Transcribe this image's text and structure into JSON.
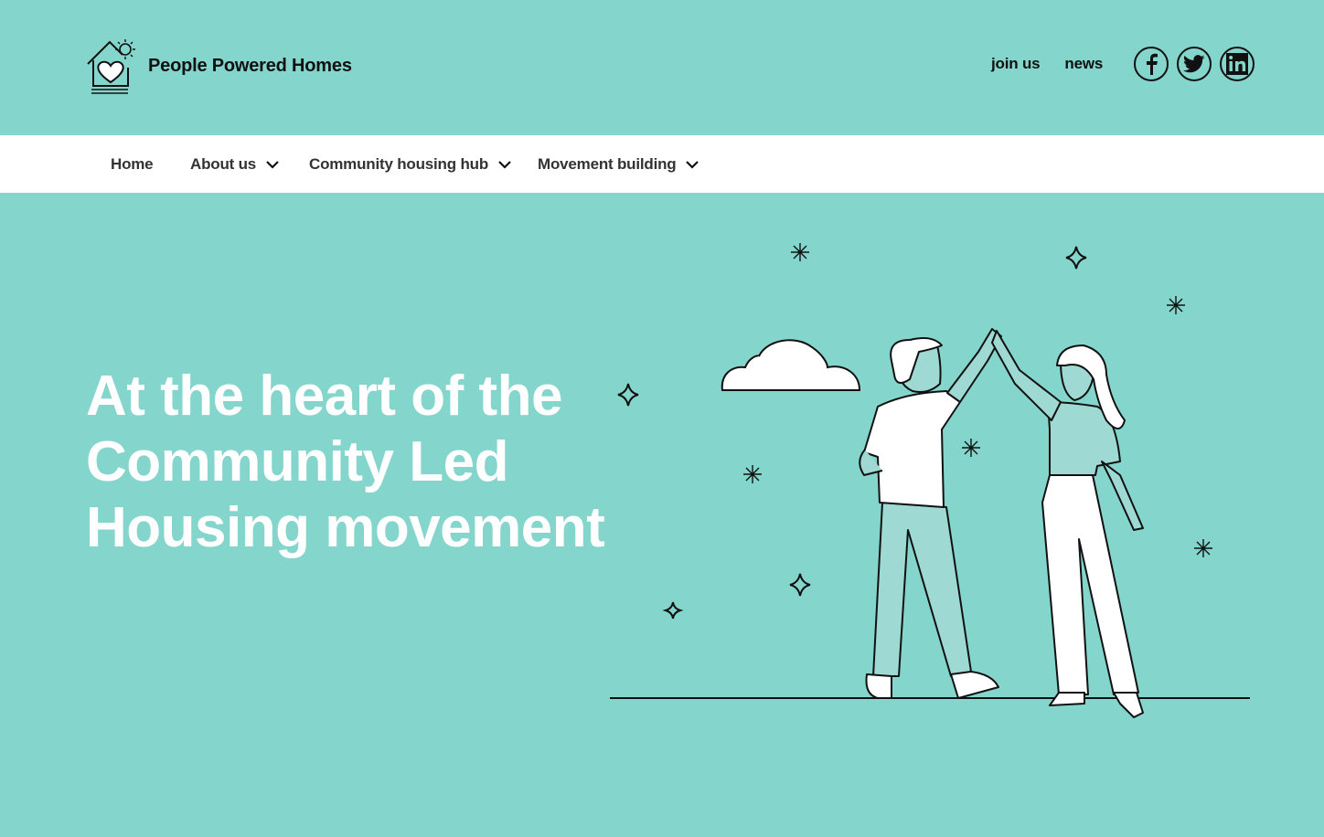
{
  "brand": {
    "name": "People Powered Homes",
    "logo_icon": "house-heart-icon"
  },
  "top_links": [
    {
      "label": "join us"
    },
    {
      "label": "news"
    }
  ],
  "social": [
    {
      "icon": "facebook-icon"
    },
    {
      "icon": "twitter-icon"
    },
    {
      "icon": "linkedin-icon"
    }
  ],
  "nav": [
    {
      "label": "Home"
    },
    {
      "label": "About us"
    },
    {
      "label": "Community housing hub"
    },
    {
      "label": "Movement building"
    }
  ],
  "hero": {
    "line1": "At the heart of the",
    "line2": "Community Led",
    "line3": "Housing movement"
  },
  "colors": {
    "background": "#84d5cc",
    "nav_bg": "#ffffff",
    "hero_text": "#ffffff",
    "ink": "#111111",
    "figure_fill": "#9ed9d3"
  }
}
